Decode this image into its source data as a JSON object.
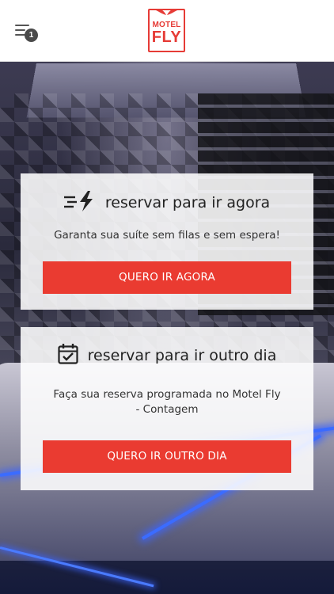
{
  "header": {
    "menu_badge": "1",
    "logo_line1": "MOTEL",
    "logo_line2": "FLY",
    "brand_color": "#e63b36"
  },
  "cards": {
    "now": {
      "icon": "fast-lightning-icon",
      "title": "reservar para ir agora",
      "description": "Garanta sua suíte sem filas e sem espera!",
      "button_label": "QUERO IR AGORA"
    },
    "later": {
      "icon": "calendar-check-icon",
      "title": "reservar para ir outro dia",
      "description": "Faça sua reserva programada no Motel Fly - Contagem",
      "button_label": "QUERO IR OUTRO DIA"
    }
  },
  "colors": {
    "accent": "#ea3b31",
    "card_background": "#ffffff",
    "header_background": "#ffffff"
  }
}
